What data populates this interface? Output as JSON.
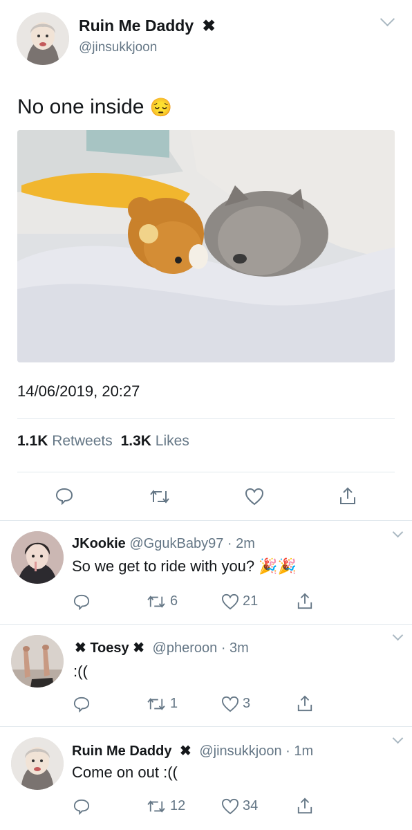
{
  "main_tweet": {
    "display_name": "Ruin Me Daddy",
    "name_suffix": "✖",
    "handle": "@jinsukkjoon",
    "text": "No one inside",
    "emoji": "😔",
    "timestamp": "14/06/2019, 20:27",
    "retweets_count": "1.1K",
    "retweets_label": "Retweets",
    "likes_count": "1.3K",
    "likes_label": "Likes"
  },
  "replies": [
    {
      "display_name": "JKookie",
      "handle": "@GgukBaby97",
      "time": "· 2m",
      "text": "So we get to ride with you?",
      "emoji": "🎉🎉",
      "retweets": "6",
      "likes": "21"
    },
    {
      "prefix": "✖",
      "display_name": "Toesy",
      "suffix": "✖",
      "handle": "@pheroon",
      "time": "· 3m",
      "text": ":((",
      "retweets": "1",
      "likes": "3"
    },
    {
      "display_name": "Ruin Me Daddy",
      "suffix": "✖",
      "handle": "@jinsukkjoon",
      "time": "· 1m",
      "text": "Come on out :((",
      "retweets": "12",
      "likes": "34"
    }
  ],
  "icons": {
    "reply": "reply-icon",
    "retweet": "retweet-icon",
    "like": "heart-icon",
    "share": "share-icon",
    "more": "chevron-down-icon"
  },
  "colors": {
    "text": "#14171a",
    "secondary": "#657786",
    "divider": "#e1e8ed",
    "icon": "#657786"
  }
}
